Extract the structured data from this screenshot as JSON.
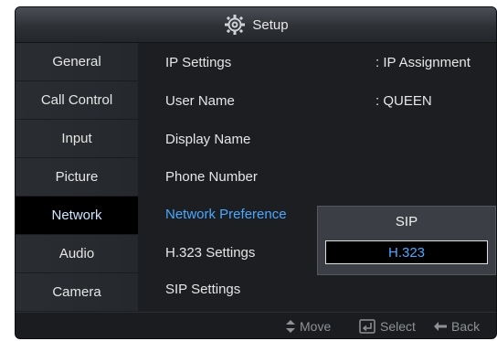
{
  "window": {
    "title": "Setup",
    "icon": "gear-icon"
  },
  "sidebar": {
    "items": [
      {
        "label": "General"
      },
      {
        "label": "Call Control"
      },
      {
        "label": "Input"
      },
      {
        "label": "Picture"
      },
      {
        "label": "Network",
        "active": true
      },
      {
        "label": "Audio"
      },
      {
        "label": "Camera"
      }
    ]
  },
  "settings": {
    "rows": [
      {
        "label": "IP Settings",
        "value": ": IP Assignment"
      },
      {
        "label": "User Name",
        "value": ": QUEEN"
      },
      {
        "label": "Display Name"
      },
      {
        "label": "Phone Number"
      },
      {
        "label": "Network Preference",
        "highlight": true
      },
      {
        "label": "H.323 Settings"
      },
      {
        "label": "SIP Settings"
      }
    ]
  },
  "dropdown": {
    "options": [
      {
        "label": "SIP"
      },
      {
        "label": "H.323",
        "selected": true
      }
    ]
  },
  "footer": {
    "move_label": "Move",
    "select_label": "Select",
    "back_label": "Back"
  },
  "colors": {
    "highlight": "#4aa8ff",
    "background": "#1f2124",
    "active_item": "#000000"
  }
}
